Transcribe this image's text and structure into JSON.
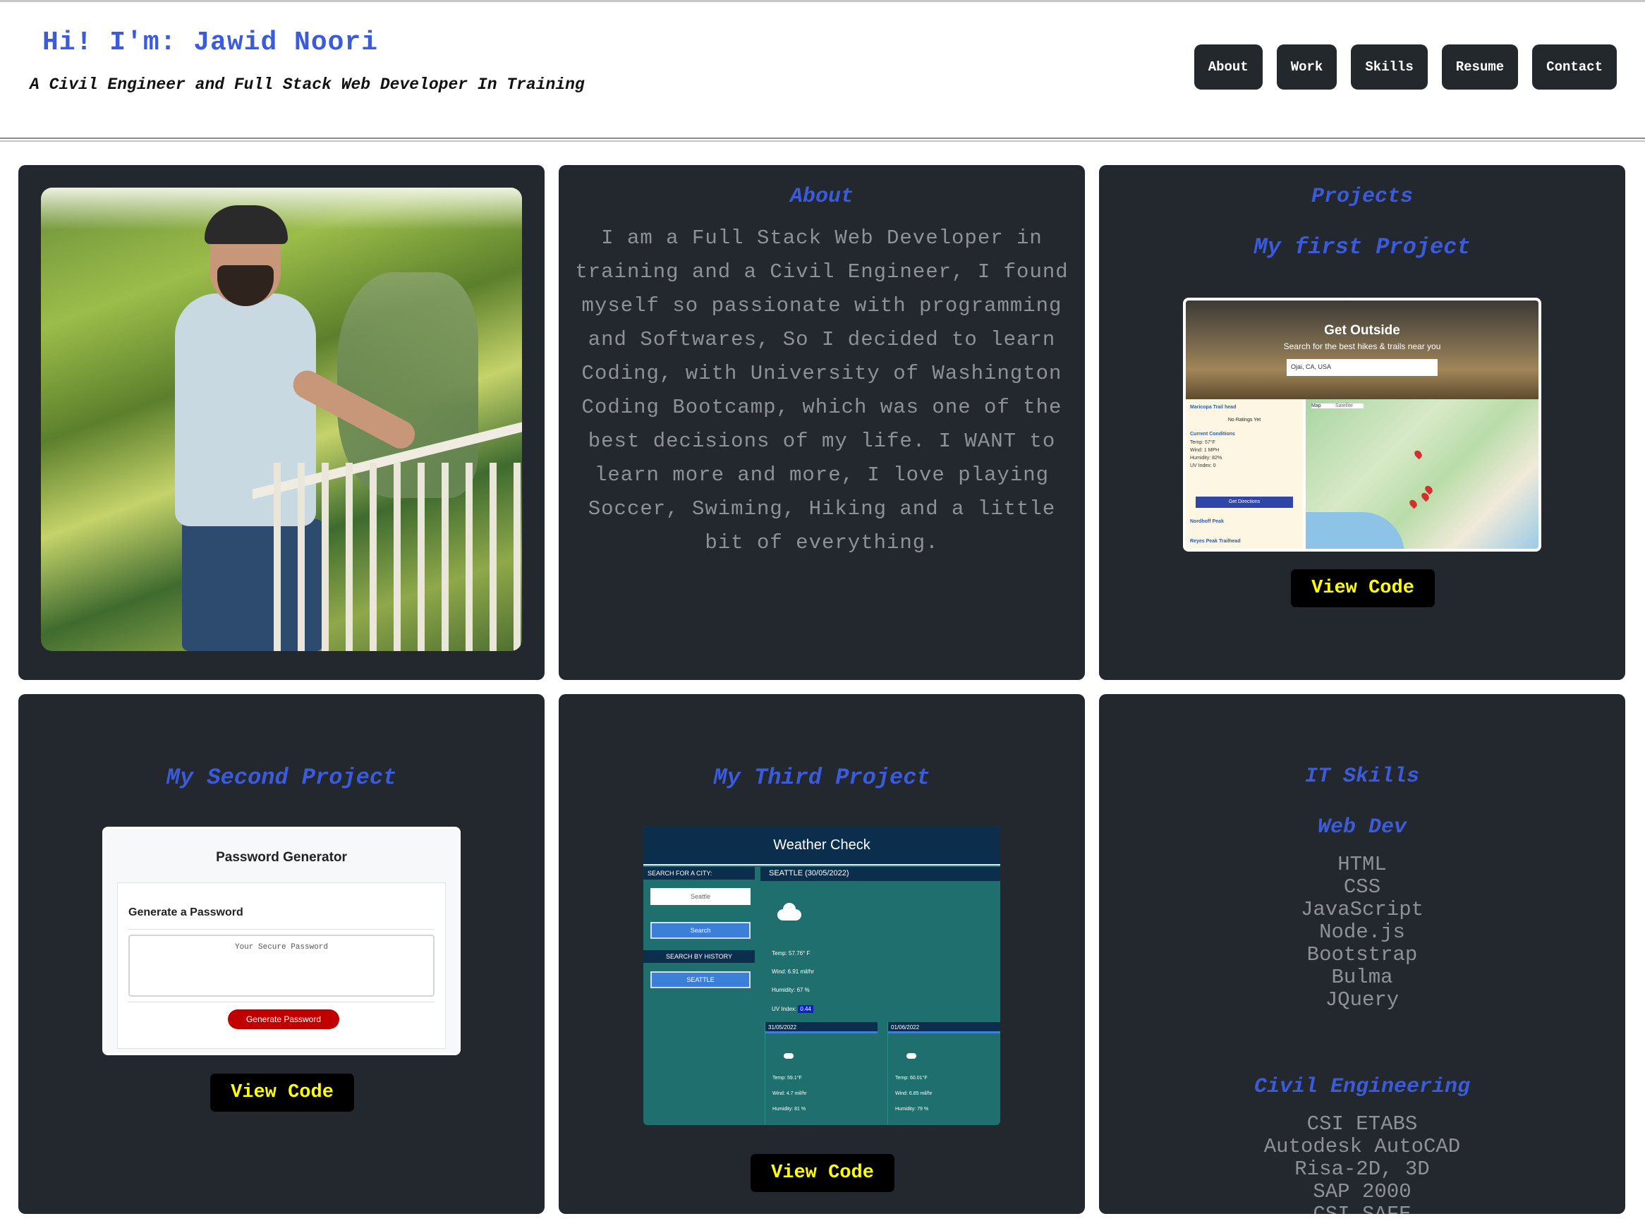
{
  "header": {
    "title": "Hi! I'm: Jawid Noori",
    "subtitle": "A Civil Engineer and Full Stack Web Developer In Training",
    "nav": [
      "About",
      "Work",
      "Skills",
      "Resume",
      "Contact"
    ]
  },
  "about": {
    "heading": "About",
    "text": "I am a Full Stack Web Developer in training and a Civil Engineer, I found myself so passionate with programming and Softwares, So I decided to learn Coding, with University of Washington Coding Bootcamp, which was one of the best decisions of my life. I WANT to learn more and more, I love playing Soccer, Swiming, Hiking and a little bit of everything."
  },
  "projects": {
    "heading": "Projects",
    "first": {
      "title": "My first Project",
      "view_code": "View Code",
      "screenshot": {
        "hero_title": "Get Outside",
        "hero_sub": "Search for the best hikes & trails near you",
        "search_value": "Ojai, CA, USA",
        "side_items": [
          "Maricopa Trail head",
          "No Ratings Yet",
          "Current Conditions",
          "Temp: 57°F",
          "Wind: 1 MPH",
          "Humidity: 82%",
          "UV Index: 0",
          "Get Directions",
          "Nordhoff Peak",
          "Reyes Peak Trailhead"
        ],
        "map_tabs": [
          "Map",
          "Satellite"
        ]
      }
    },
    "second": {
      "title": "My Second Project",
      "view_code": "View Code",
      "screenshot": {
        "title": "Password Generator",
        "label": "Generate a Password",
        "placeholder": "Your Secure Password",
        "button": "Generate Password"
      }
    },
    "third": {
      "title": "My Third Project",
      "view_code": "View Code",
      "screenshot": {
        "app_title": "Weather Check",
        "search_label": "SEARCH FOR A CITY:",
        "search_placeholder": "Seattle",
        "search_button": "Search",
        "history_label": "SEARCH BY HISTORY",
        "history_item": "SEATTLE",
        "city_header": "SEATTLE    (30/05/2022)",
        "temp": "Temp: 57.76° F",
        "wind": "Wind: 6.91 mil/hr",
        "humidity": "Humidity: 67 %",
        "uv_label": "UV Index:",
        "uv_value": "0.44",
        "forecast": [
          {
            "date": "31/05/2022",
            "temp": "Temp: 59.1°F",
            "wind": "Wind: 4.7 mil/hr",
            "humidity": "Humidity: 81 %"
          },
          {
            "date": "01/06/2022",
            "temp": "Temp: 60.01°F",
            "wind": "Wind: 6.85 mil/hr",
            "humidity": "Humidity: 79 %"
          }
        ]
      }
    }
  },
  "skills": {
    "heading": "IT Skills",
    "web_heading": "Web Dev",
    "web": [
      "HTML",
      "CSS",
      "JavaScript",
      "Node.js",
      "Bootstrap",
      "Bulma",
      "JQuery"
    ],
    "civil_heading": "Civil Engineering",
    "civil": [
      "CSI ETABS",
      "Autodesk AutoCAD",
      "Risa-2D, 3D",
      "SAP 2000",
      "CSI SAFE"
    ]
  },
  "colors": {
    "accent": "#3b5bdb",
    "card": "#22282e",
    "button_text": "#ffff00",
    "muted_text": "#8e9297"
  }
}
